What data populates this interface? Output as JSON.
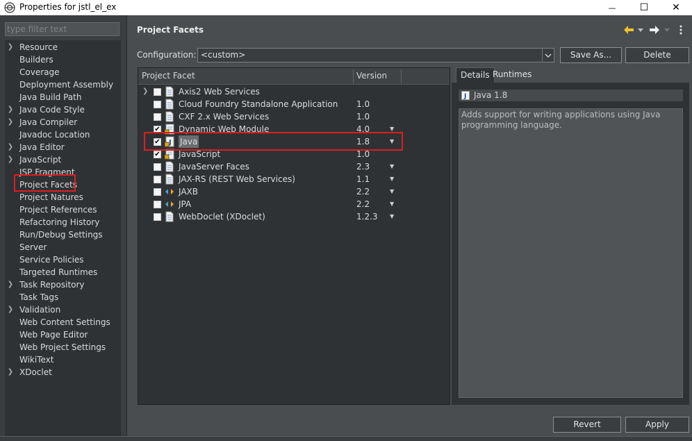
{
  "window": {
    "title": "Properties for jstl_el_ex",
    "minimize": "—",
    "maximize": "☐",
    "close": "✕"
  },
  "filter": {
    "placeholder": "type filter text",
    "value": ""
  },
  "sidebar": {
    "items": [
      {
        "label": "Resource",
        "expandable": true
      },
      {
        "label": "Builders",
        "expandable": false
      },
      {
        "label": "Coverage",
        "expandable": false
      },
      {
        "label": "Deployment Assembly",
        "expandable": false
      },
      {
        "label": "Java Build Path",
        "expandable": false
      },
      {
        "label": "Java Code Style",
        "expandable": true
      },
      {
        "label": "Java Compiler",
        "expandable": true
      },
      {
        "label": "Javadoc Location",
        "expandable": false
      },
      {
        "label": "Java Editor",
        "expandable": true
      },
      {
        "label": "JavaScript",
        "expandable": true
      },
      {
        "label": "JSP Fragment",
        "expandable": false
      },
      {
        "label": "Project Facets",
        "expandable": false,
        "selected": true
      },
      {
        "label": "Project Natures",
        "expandable": false
      },
      {
        "label": "Project References",
        "expandable": false
      },
      {
        "label": "Refactoring History",
        "expandable": false
      },
      {
        "label": "Run/Debug Settings",
        "expandable": false
      },
      {
        "label": "Server",
        "expandable": false
      },
      {
        "label": "Service Policies",
        "expandable": false
      },
      {
        "label": "Targeted Runtimes",
        "expandable": false
      },
      {
        "label": "Task Repository",
        "expandable": true
      },
      {
        "label": "Task Tags",
        "expandable": false
      },
      {
        "label": "Validation",
        "expandable": true
      },
      {
        "label": "Web Content Settings",
        "expandable": false
      },
      {
        "label": "Web Page Editor",
        "expandable": false
      },
      {
        "label": "Web Project Settings",
        "expandable": false
      },
      {
        "label": "WikiText",
        "expandable": false
      },
      {
        "label": "XDoclet",
        "expandable": true
      }
    ]
  },
  "page": {
    "title": "Project Facets",
    "configuration_label": "Configuration:",
    "configuration_value": "<custom>",
    "save_as_label": "Save As...",
    "delete_label": "Delete",
    "revert_label": "Revert",
    "apply_label": "Apply"
  },
  "facets": {
    "col_facet": "Project Facet",
    "col_version": "Version",
    "rows": [
      {
        "name": "Axis2 Web Services",
        "version": "",
        "checked": false,
        "expandable": true,
        "dropdown": false,
        "icon": "doc-icon"
      },
      {
        "name": "Cloud Foundry Standalone Application",
        "version": "1.0",
        "checked": false,
        "expandable": false,
        "dropdown": false,
        "icon": "doc-icon"
      },
      {
        "name": "CXF 2.x Web Services",
        "version": "1.0",
        "checked": false,
        "expandable": false,
        "dropdown": false,
        "icon": "doc-icon"
      },
      {
        "name": "Dynamic Web Module",
        "version": "4.0",
        "checked": true,
        "expandable": false,
        "dropdown": true,
        "icon": "lock-doc-icon"
      },
      {
        "name": "Java",
        "version": "1.8",
        "checked": true,
        "expandable": false,
        "dropdown": true,
        "icon": "java-lock-icon",
        "selected": true
      },
      {
        "name": "JavaScript",
        "version": "1.0",
        "checked": true,
        "expandable": false,
        "dropdown": false,
        "icon": "lock-doc-icon"
      },
      {
        "name": "JavaServer Faces",
        "version": "2.3",
        "checked": false,
        "expandable": false,
        "dropdown": true,
        "icon": "doc-icon"
      },
      {
        "name": "JAX-RS (REST Web Services)",
        "version": "1.1",
        "checked": false,
        "expandable": false,
        "dropdown": true,
        "icon": "doc-icon"
      },
      {
        "name": "JAXB",
        "version": "2.2",
        "checked": false,
        "expandable": false,
        "dropdown": true,
        "icon": "jaxb-icon"
      },
      {
        "name": "JPA",
        "version": "2.2",
        "checked": false,
        "expandable": false,
        "dropdown": true,
        "icon": "jaxb-icon"
      },
      {
        "name": "WebDoclet (XDoclet)",
        "version": "1.2.3",
        "checked": false,
        "expandable": false,
        "dropdown": true,
        "icon": "doc-icon"
      }
    ]
  },
  "details": {
    "tab_details": "Details",
    "tab_runtimes": "Runtimes",
    "heading": "Java 1.8",
    "description": "Adds support for writing applications using Java programming language."
  },
  "colors": {
    "highlight_border": "#e01e1e",
    "panel_bg": "#2f3235",
    "window_bg": "#4a4d4f"
  }
}
